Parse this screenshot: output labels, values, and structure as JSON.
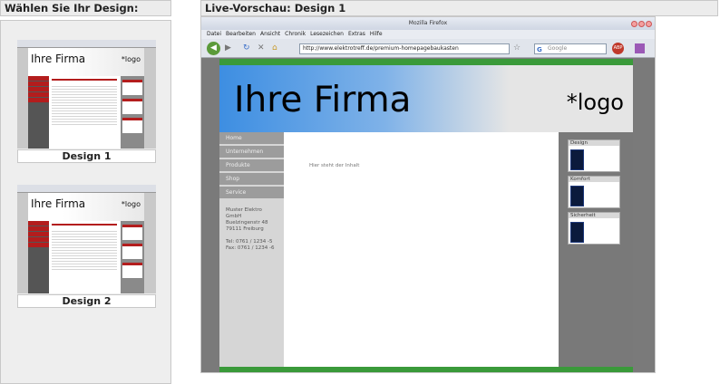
{
  "left_header": "Wählen Sie Ihr Design:",
  "right_header": "Live-Vorschau: Design 1",
  "designs": [
    {
      "label": "Design 1",
      "thumb_title": "Ihre Firma",
      "thumb_logo": "*logo"
    },
    {
      "label": "Design 2",
      "thumb_title": "Ihre Firma",
      "thumb_logo": "*logo"
    }
  ],
  "browser": {
    "window_title": "Mozilla Firefox",
    "menu": [
      "Datei",
      "Bearbeiten",
      "Ansicht",
      "Chronik",
      "Lesezeichen",
      "Extras",
      "Hilfe"
    ],
    "url": "http://www.elektrotreff.de/premium-homepagebaukasten",
    "search_placeholder": "Google"
  },
  "site": {
    "title": "Ihre Firma",
    "logo": "*logo",
    "nav": [
      "Home",
      "Unternehmen",
      "Produkte",
      "Shop",
      "Service"
    ],
    "address": [
      "Muster Elektro GmbH",
      "Buelzingenstr 48",
      "79111 Freiburg",
      "",
      "Tel: 0761 / 1234 -5",
      "Fax: 0761 / 1234 -6"
    ],
    "main_placeholder": "Hier steht der Inhalt",
    "sidebar_boxes": [
      {
        "title": "Design"
      },
      {
        "title": "Komfort"
      },
      {
        "title": "Sicherheit"
      }
    ]
  },
  "colors": {
    "accent_green": "#3a9a3a",
    "thumb_red": "#b31d1d",
    "header_blue": "#3d8ee2"
  }
}
